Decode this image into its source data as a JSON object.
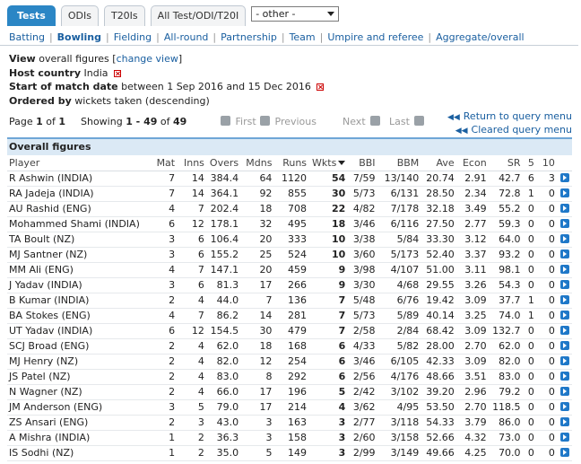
{
  "tabs": [
    {
      "label": "Tests",
      "active": true
    },
    {
      "label": "ODIs",
      "active": false
    },
    {
      "label": "T20Is",
      "active": false
    },
    {
      "label": "All Test/ODI/T20I",
      "active": false
    }
  ],
  "format_select": {
    "value": "- other -"
  },
  "nav": [
    {
      "label": "Batting",
      "active": false
    },
    {
      "label": "Bowling",
      "active": true
    },
    {
      "label": "Fielding",
      "active": false
    },
    {
      "label": "All-round",
      "active": false
    },
    {
      "label": "Partnership",
      "active": false
    },
    {
      "label": "Team",
      "active": false
    },
    {
      "label": "Umpire and referee",
      "active": false
    },
    {
      "label": "Aggregate/overall",
      "active": false
    }
  ],
  "query": {
    "view_label": "View",
    "view_value": "overall figures",
    "change_view": "change view",
    "host_label": "Host country",
    "host_value": "India",
    "date_label": "Start of match date",
    "date_value": "between 1 Sep 2016 and 15 Dec 2016",
    "order_label": "Ordered by",
    "order_value": "wickets taken (descending)"
  },
  "pager": {
    "page_prefix": "Page",
    "page_current": "1",
    "page_of": "of",
    "page_total": "1",
    "showing_prefix": "Showing",
    "showing_range": "1 - 49",
    "showing_of": "of",
    "showing_total": "49",
    "first": "First",
    "previous": "Previous",
    "next": "Next",
    "last": "Last",
    "return_link": "Return to query menu",
    "cleared_link": "Cleared query menu"
  },
  "table": {
    "title": "Overall figures",
    "columns": [
      "Player",
      "Mat",
      "Inns",
      "Overs",
      "Mdns",
      "Runs",
      "Wkts",
      "BBI",
      "BBM",
      "Ave",
      "Econ",
      "SR",
      "5",
      "10"
    ],
    "rows": [
      [
        "R Ashwin (INDIA)",
        "7",
        "14",
        "384.4",
        "64",
        "1120",
        "54",
        "7/59",
        "13/140",
        "20.74",
        "2.91",
        "42.7",
        "6",
        "3"
      ],
      [
        "RA Jadeja (INDIA)",
        "7",
        "14",
        "364.1",
        "92",
        "855",
        "30",
        "5/73",
        "6/131",
        "28.50",
        "2.34",
        "72.8",
        "1",
        "0"
      ],
      [
        "AU Rashid (ENG)",
        "4",
        "7",
        "202.4",
        "18",
        "708",
        "22",
        "4/82",
        "7/178",
        "32.18",
        "3.49",
        "55.2",
        "0",
        "0"
      ],
      [
        "Mohammed Shami (INDIA)",
        "6",
        "12",
        "178.1",
        "32",
        "495",
        "18",
        "3/46",
        "6/116",
        "27.50",
        "2.77",
        "59.3",
        "0",
        "0"
      ],
      [
        "TA Boult (NZ)",
        "3",
        "6",
        "106.4",
        "20",
        "333",
        "10",
        "3/38",
        "5/84",
        "33.30",
        "3.12",
        "64.0",
        "0",
        "0"
      ],
      [
        "MJ Santner (NZ)",
        "3",
        "6",
        "155.2",
        "25",
        "524",
        "10",
        "3/60",
        "5/173",
        "52.40",
        "3.37",
        "93.2",
        "0",
        "0"
      ],
      [
        "MM Ali (ENG)",
        "4",
        "7",
        "147.1",
        "20",
        "459",
        "9",
        "3/98",
        "4/107",
        "51.00",
        "3.11",
        "98.1",
        "0",
        "0"
      ],
      [
        "J Yadav (INDIA)",
        "3",
        "6",
        "81.3",
        "17",
        "266",
        "9",
        "3/30",
        "4/68",
        "29.55",
        "3.26",
        "54.3",
        "0",
        "0"
      ],
      [
        "B Kumar (INDIA)",
        "2",
        "4",
        "44.0",
        "7",
        "136",
        "7",
        "5/48",
        "6/76",
        "19.42",
        "3.09",
        "37.7",
        "1",
        "0"
      ],
      [
        "BA Stokes (ENG)",
        "4",
        "7",
        "86.2",
        "14",
        "281",
        "7",
        "5/73",
        "5/89",
        "40.14",
        "3.25",
        "74.0",
        "1",
        "0"
      ],
      [
        "UT Yadav (INDIA)",
        "6",
        "12",
        "154.5",
        "30",
        "479",
        "7",
        "2/58",
        "2/84",
        "68.42",
        "3.09",
        "132.7",
        "0",
        "0"
      ],
      [
        "SCJ Broad (ENG)",
        "2",
        "4",
        "62.0",
        "18",
        "168",
        "6",
        "4/33",
        "5/82",
        "28.00",
        "2.70",
        "62.0",
        "0",
        "0"
      ],
      [
        "MJ Henry (NZ)",
        "2",
        "4",
        "82.0",
        "12",
        "254",
        "6",
        "3/46",
        "6/105",
        "42.33",
        "3.09",
        "82.0",
        "0",
        "0"
      ],
      [
        "JS Patel (NZ)",
        "2",
        "4",
        "83.0",
        "8",
        "292",
        "6",
        "2/56",
        "4/176",
        "48.66",
        "3.51",
        "83.0",
        "0",
        "0"
      ],
      [
        "N Wagner (NZ)",
        "2",
        "4",
        "66.0",
        "17",
        "196",
        "5",
        "2/42",
        "3/102",
        "39.20",
        "2.96",
        "79.2",
        "0",
        "0"
      ],
      [
        "JM Anderson (ENG)",
        "3",
        "5",
        "79.0",
        "17",
        "214",
        "4",
        "3/62",
        "4/95",
        "53.50",
        "2.70",
        "118.5",
        "0",
        "0"
      ],
      [
        "ZS Ansari (ENG)",
        "2",
        "3",
        "43.0",
        "3",
        "163",
        "3",
        "2/77",
        "3/118",
        "54.33",
        "3.79",
        "86.0",
        "0",
        "0"
      ],
      [
        "A Mishra (INDIA)",
        "1",
        "2",
        "36.3",
        "3",
        "158",
        "3",
        "2/60",
        "3/158",
        "52.66",
        "4.32",
        "73.0",
        "0",
        "0"
      ],
      [
        "IS Sodhi (NZ)",
        "1",
        "2",
        "35.0",
        "5",
        "149",
        "3",
        "2/99",
        "3/149",
        "49.66",
        "4.25",
        "70.0",
        "0",
        "0"
      ]
    ]
  },
  "colors": {
    "accent": "#2b86c5",
    "link": "#1a5fa0",
    "title_bg": "#dbe9f5"
  }
}
